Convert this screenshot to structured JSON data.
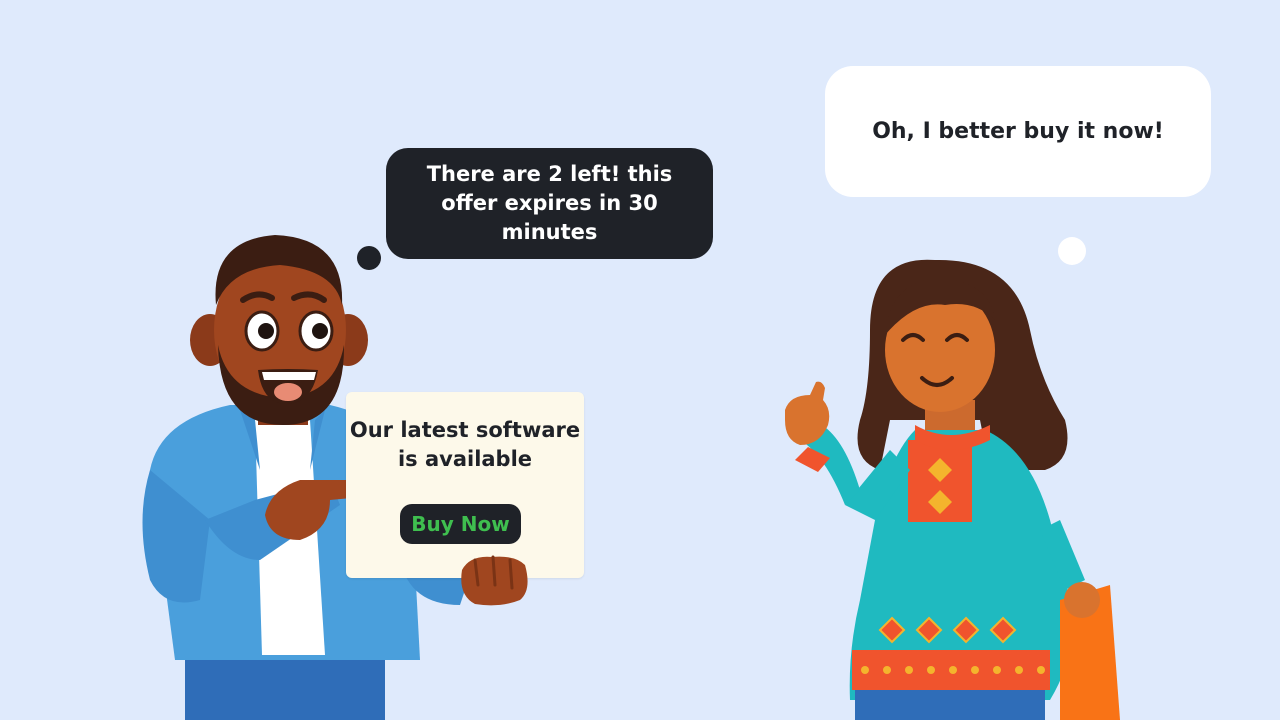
{
  "speech": {
    "man": "There are 2 left! this offer expires in 30 minutes",
    "woman": "Oh, I better buy it now!"
  },
  "sign": {
    "text": "Our latest software is available",
    "button_label": "Buy Now"
  },
  "colors": {
    "background": "#dfeafc",
    "dark_bubble": "#1f2228",
    "sign": "#fdf9ea",
    "button_text": "#3fbf4f"
  }
}
